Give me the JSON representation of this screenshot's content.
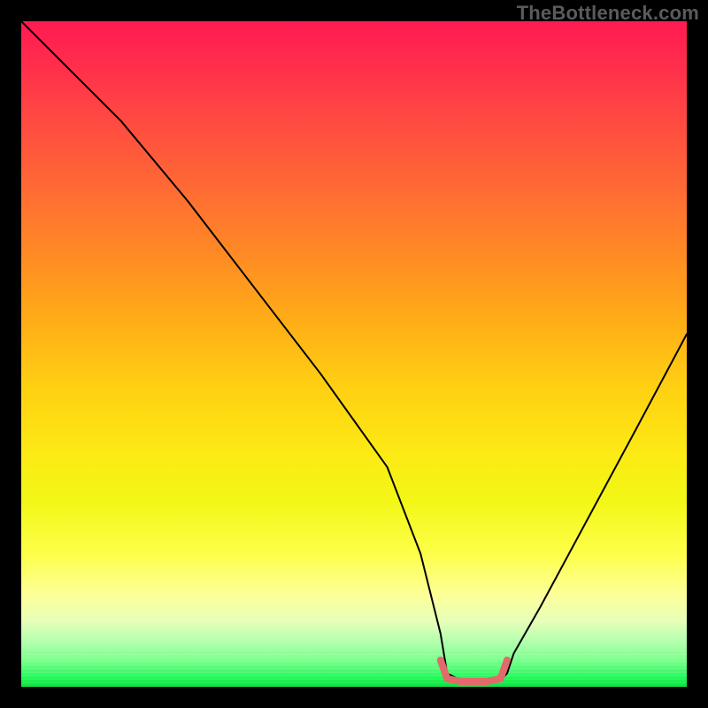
{
  "watermark": "TheBottleneck.com",
  "chart_data": {
    "type": "line",
    "title": "",
    "xlabel": "",
    "ylabel": "",
    "xlim": [
      0,
      100
    ],
    "ylim": [
      0,
      100
    ],
    "background": "rainbow-vertical-gradient",
    "grid": false,
    "legend": false,
    "series": [
      {
        "name": "bottleneck-curve",
        "color": "#000000",
        "stroke_width": 2,
        "x": [
          0,
          3,
          8,
          15,
          25,
          35,
          45,
          55,
          60,
          63,
          64,
          66,
          72,
          73,
          74,
          78,
          85,
          92,
          100
        ],
        "values": [
          100,
          97,
          92,
          85,
          73,
          60,
          47,
          33,
          20,
          8,
          2,
          1,
          1,
          2,
          5,
          12,
          25,
          38,
          53
        ]
      },
      {
        "name": "optimal-band-marker",
        "color": "#e26a6a",
        "stroke_width": 8,
        "x": [
          63,
          64,
          66,
          70,
          72,
          73
        ],
        "values": [
          4,
          1.2,
          0.8,
          0.8,
          1.2,
          4
        ]
      }
    ],
    "annotations": []
  }
}
